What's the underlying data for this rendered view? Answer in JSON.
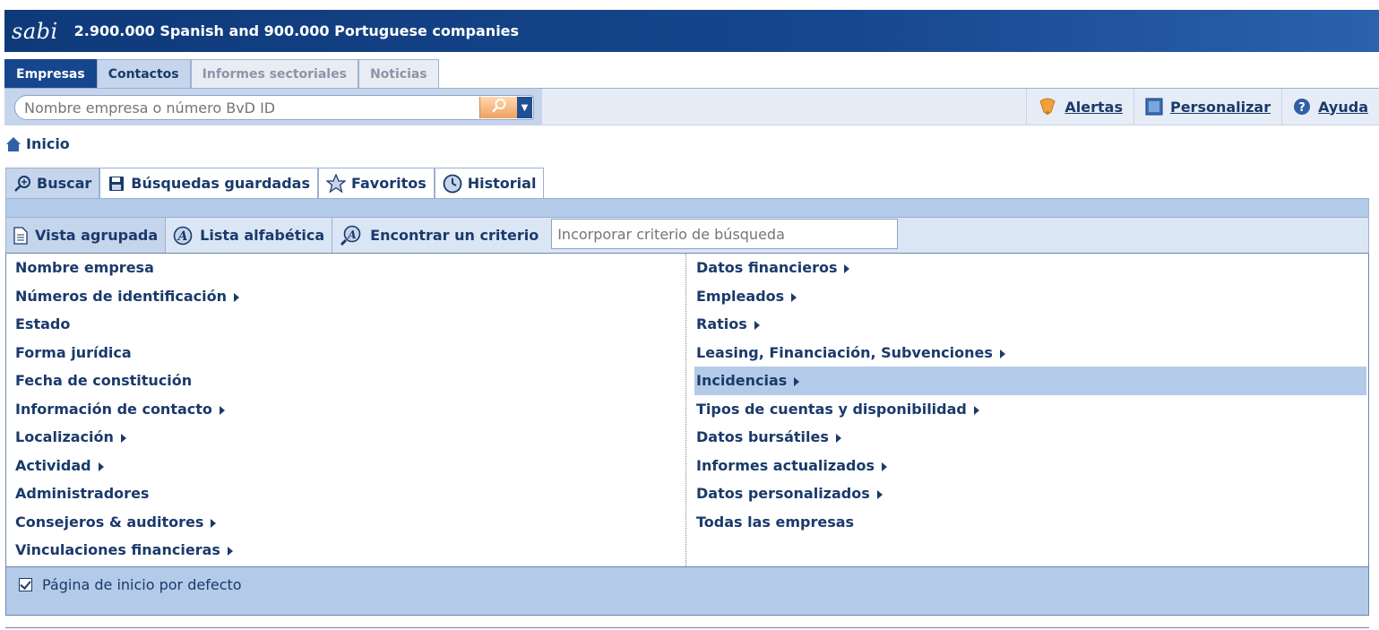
{
  "header": {
    "logo": "sabi",
    "tagline": "2.900.000 Spanish and 900.000 Portuguese companies"
  },
  "top_tabs": [
    {
      "label": "Empresas",
      "state": "active"
    },
    {
      "label": "Contactos",
      "state": "normal"
    },
    {
      "label": "Informes sectoriales",
      "state": "disabled"
    },
    {
      "label": "Noticias",
      "state": "disabled"
    }
  ],
  "search": {
    "placeholder": "Nombre empresa o número BvD ID",
    "value": ""
  },
  "toolbar": {
    "alerts_label": "Alertas",
    "customize_label": "Personalizar",
    "help_label": "Ayuda"
  },
  "breadcrumb": {
    "home_label": "Inicio"
  },
  "section_tabs": [
    {
      "label": "Buscar",
      "icon": "search-plus-icon"
    },
    {
      "label": "Búsquedas guardadas",
      "icon": "floppy-disk-icon"
    },
    {
      "label": "Favoritos",
      "icon": "star-icon"
    },
    {
      "label": "Historial",
      "icon": "clock-icon"
    }
  ],
  "view_bar": {
    "grouped_label": "Vista agrupada",
    "alphabetical_label": "Lista alfabética",
    "find_label": "Encontrar un criterio",
    "criteria_placeholder": "Incorporar criterio de búsqueda"
  },
  "criteria_left": [
    {
      "label": "Nombre empresa",
      "has_submenu": false
    },
    {
      "label": "Números de identificación",
      "has_submenu": true
    },
    {
      "label": "Estado",
      "has_submenu": false
    },
    {
      "label": "Forma jurídica",
      "has_submenu": false
    },
    {
      "label": "Fecha de constitución",
      "has_submenu": false
    },
    {
      "label": "Información de contacto",
      "has_submenu": true
    },
    {
      "label": "Localización",
      "has_submenu": true
    },
    {
      "label": "Actividad",
      "has_submenu": true
    },
    {
      "label": "Administradores",
      "has_submenu": false
    },
    {
      "label": "Consejeros & auditores",
      "has_submenu": true
    },
    {
      "label": "Vinculaciones financieras",
      "has_submenu": true
    }
  ],
  "criteria_right": [
    {
      "label": "Datos financieros",
      "has_submenu": true
    },
    {
      "label": "Empleados",
      "has_submenu": true
    },
    {
      "label": "Ratios",
      "has_submenu": true
    },
    {
      "label": "Leasing, Financiación, Subvenciones",
      "has_submenu": true
    },
    {
      "label": "Incidencias",
      "has_submenu": true,
      "highlighted": true
    },
    {
      "label": "Tipos de cuentas y disponibilidad",
      "has_submenu": true
    },
    {
      "label": "Datos bursátiles",
      "has_submenu": true
    },
    {
      "label": "Informes actualizados",
      "has_submenu": true
    },
    {
      "label": "Datos personalizados",
      "has_submenu": true
    },
    {
      "label": "Todas las empresas",
      "has_submenu": false
    }
  ],
  "footer": {
    "default_home_label": "Página de inicio por defecto",
    "default_home_checked": true
  },
  "colors": {
    "brand_dark": "#16468d",
    "panel_blue": "#b3cae8",
    "text": "#1a3a6b",
    "search_button": "#f0a060"
  }
}
